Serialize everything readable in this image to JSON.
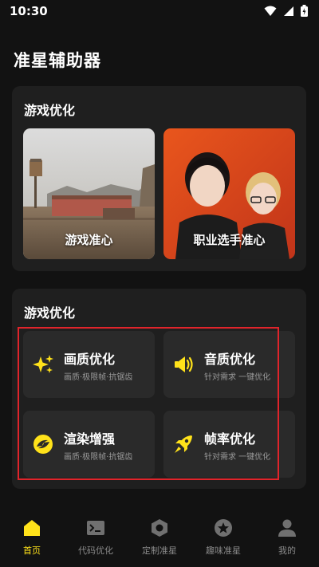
{
  "status_bar": {
    "time": "10:30"
  },
  "app": {
    "title": "准星辅助器"
  },
  "sections": [
    {
      "title": "游戏优化",
      "cards": [
        {
          "label": "游戏准心",
          "image": "desert-map-scene"
        },
        {
          "label": "职业选手准心",
          "image": "pro-players-photo"
        }
      ]
    },
    {
      "title": "游戏优化",
      "options": [
        {
          "title": "画质优化",
          "subtitle": "画质·极限帧·抗锯齿",
          "icon": "sparkle-icon"
        },
        {
          "title": "音质优化",
          "subtitle": "针对需求 一键优化",
          "icon": "speaker-icon"
        },
        {
          "title": "渲染增强",
          "subtitle": "画质·极限帧·抗锯齿",
          "icon": "render-icon"
        },
        {
          "title": "帧率优化",
          "subtitle": "针对需求 一键优化",
          "icon": "rocket-icon"
        }
      ]
    }
  ],
  "bottom_nav": [
    {
      "label": "首页",
      "icon": "home-icon",
      "active": true
    },
    {
      "label": "代码优化",
      "icon": "terminal-icon",
      "active": false
    },
    {
      "label": "定制准星",
      "icon": "hexagon-icon",
      "active": false
    },
    {
      "label": "趣味准星",
      "icon": "star-badge-icon",
      "active": false
    },
    {
      "label": "我的",
      "icon": "user-icon",
      "active": false
    }
  ],
  "colors": {
    "accent": "#ffe21a",
    "background": "#121212",
    "card": "#1f1f1f",
    "tile": "#2a2a2a",
    "highlight": "#e0242b"
  }
}
